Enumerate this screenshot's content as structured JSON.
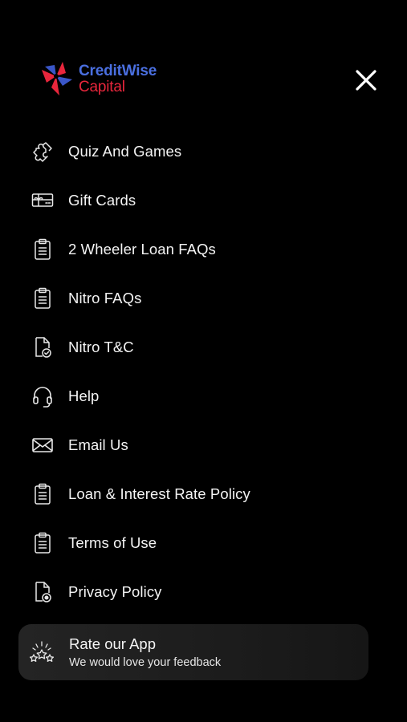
{
  "brand": {
    "line1_a": "Credit",
    "line1_b": "Wise",
    "line2": "Capital",
    "colors": {
      "blue": "#4a6fe0",
      "red": "#e8263c",
      "background": "#000000"
    }
  },
  "header": {
    "close_icon": "close-icon"
  },
  "menu": {
    "items": [
      {
        "label": "Quiz And Games",
        "icon": "puzzle-icon"
      },
      {
        "label": "Gift Cards",
        "icon": "gift-card-icon"
      },
      {
        "label": "2 Wheeler Loan FAQs",
        "icon": "clipboard-icon"
      },
      {
        "label": "Nitro FAQs",
        "icon": "clipboard-icon"
      },
      {
        "label": "Nitro T&C",
        "icon": "document-check-icon"
      },
      {
        "label": "Help",
        "icon": "headset-icon"
      },
      {
        "label": "Email Us",
        "icon": "mail-icon"
      },
      {
        "label": "Loan & Interest Rate Policy",
        "icon": "clipboard-icon"
      },
      {
        "label": "Terms of Use",
        "icon": "clipboard-icon"
      },
      {
        "label": "Privacy Policy",
        "icon": "document-lock-icon"
      }
    ]
  },
  "rate_card": {
    "title": "Rate our App",
    "subtitle": "We would love your feedback",
    "icon": "stars-rating-icon"
  }
}
